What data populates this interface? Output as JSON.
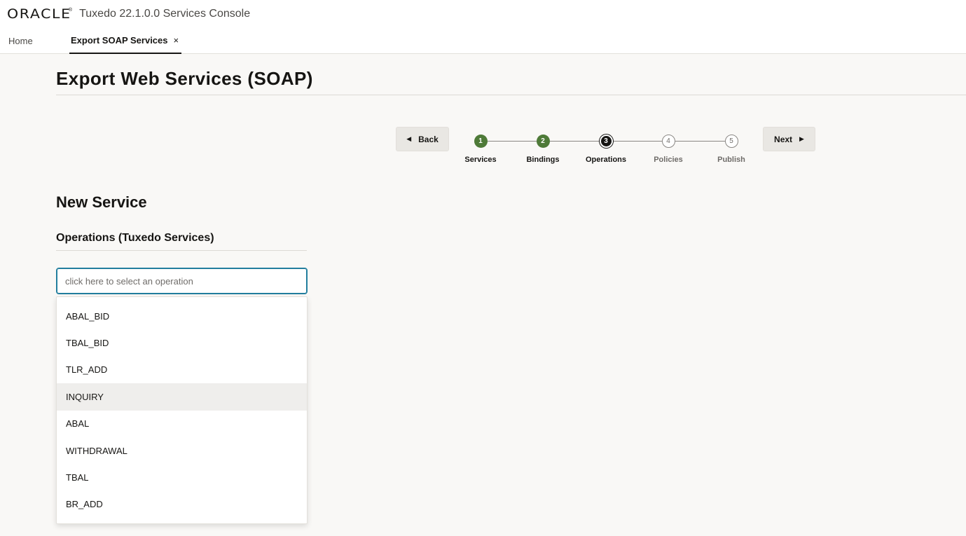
{
  "header": {
    "logo": "ORACLE",
    "app_title": "Tuxedo 22.1.0.0 Services Console"
  },
  "tabs": [
    {
      "label": "Home",
      "active": false
    },
    {
      "label": "Export SOAP Services",
      "active": true,
      "close_glyph": "×"
    }
  ],
  "page": {
    "title": "Export Web Services (SOAP)"
  },
  "train": {
    "back_label": "Back",
    "next_label": "Next",
    "steps": [
      {
        "number": "1",
        "label": "Services",
        "state": "done"
      },
      {
        "number": "2",
        "label": "Bindings",
        "state": "done"
      },
      {
        "number": "3",
        "label": "Operations",
        "state": "current"
      },
      {
        "number": "4",
        "label": "Policies",
        "state": "future"
      },
      {
        "number": "5",
        "label": "Publish",
        "state": "future"
      }
    ]
  },
  "section": {
    "title": "New Service",
    "subtitle": "Operations (Tuxedo Services)"
  },
  "operation_select": {
    "placeholder": "click here to select an operation",
    "value": "",
    "highlighted_option": "INQUIRY",
    "options": [
      "ABAL_BID",
      "TBAL_BID",
      "TLR_ADD",
      "INQUIRY",
      "ABAL",
      "WITHDRAWAL",
      "TBAL",
      "BR_ADD"
    ]
  },
  "colors": {
    "done_step": "#4e7a38",
    "current_step": "#161513",
    "focus_border": "#227e9e",
    "background": "#f9f8f6"
  }
}
